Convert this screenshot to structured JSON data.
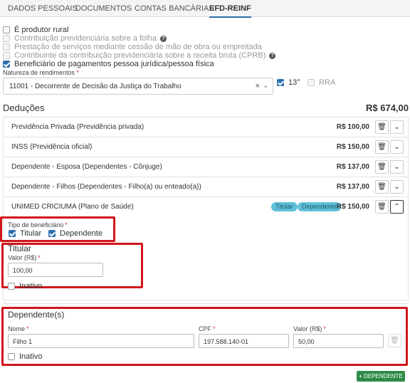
{
  "tabs": [
    "DADOS PESSOAIS",
    "DOCUMENTOS",
    "CONTAS BANCÁRIAS",
    "EFD-REINF"
  ],
  "checkboxes": [
    {
      "label": "É produtor rural",
      "checked": false,
      "disabled": false
    },
    {
      "label": "Contribuição previdenciária sobre a folha",
      "checked": false,
      "disabled": true
    },
    {
      "label": "Prestação de serviços mediante cessão de mão de obra ou empreitada",
      "checked": false,
      "disabled": true
    },
    {
      "label": "Contribuinte da contribuição previdenciária sobre a receita bruta (CPRB)",
      "checked": false,
      "disabled": true
    },
    {
      "label": "Beneficiário de pagamentos pessoa jurídica/pessoa física",
      "checked": true,
      "disabled": false
    }
  ],
  "natureza": {
    "label": "Natureza de rendimentos",
    "value": "11001 - Decorrente de Decisão da Justiça do Trabalho",
    "clear_icon": "×",
    "chevron_icon": "⌄"
  },
  "opt_13": {
    "label": "13°",
    "checked": true
  },
  "opt_rra": {
    "label": "RRA",
    "checked": false
  },
  "deducoes": {
    "title": "Deduções",
    "total": "R$ 674,00",
    "items": [
      {
        "desc": "Previdência Privada (Previdência privada)",
        "value": "R$ 100,00"
      },
      {
        "desc": "INSS (Previdência oficial)",
        "value": "R$ 150,00"
      },
      {
        "desc": "Dependente - Esposa (Dependentes - Cônjuge)",
        "value": "R$ 137,00"
      },
      {
        "desc": "Dependente - Filhos (Dependentes - Filho(a) ou enteado(a))",
        "value": "R$ 137,00"
      },
      {
        "desc": "UNIMED CRICIUMA (Plano de Saúde)",
        "value": "R$ 150,00",
        "badges": [
          "Titular",
          "Dependente"
        ]
      }
    ]
  },
  "tipo_beneficiario": {
    "label": "Tipo de beneficiário",
    "titular_label": "Titular",
    "dependente_label": "Dependente"
  },
  "titular": {
    "title": "Titular",
    "valor_label": "Valor (R$)",
    "valor": "100,00",
    "inativo_label": "Inativo"
  },
  "dependentes": {
    "title": "Dependente(s)",
    "nome_label": "Nome",
    "cpf_label": "CPF",
    "valor_label": "Valor (R$)",
    "nome": "Filho 1",
    "cpf": "197.588.140-01",
    "valor": "50,00",
    "inativo_label": "Inativo"
  },
  "add_dependente_label": "+ DEPENDENTE",
  "colors": {
    "accent": "#2e6fad",
    "highlight": "#d0161b",
    "badge": "#5fc0d9",
    "add_button": "#2e8b47"
  }
}
